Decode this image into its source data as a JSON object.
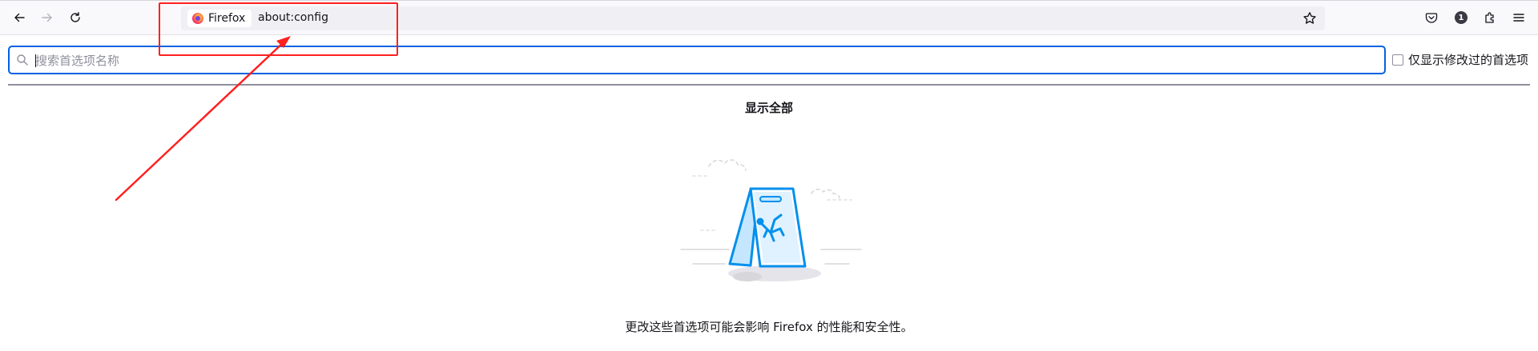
{
  "browser": {
    "identity_label": "Firefox",
    "url": "about:config",
    "notification_count": "1"
  },
  "icons": {
    "back": "arrow-left-icon",
    "forward": "arrow-right-icon",
    "reload": "reload-icon",
    "bookmark": "star-icon",
    "pocket": "pocket-icon",
    "account": "account-badge-icon",
    "extensions": "puzzle-icon",
    "menu": "hamburger-menu-icon",
    "search": "search-icon"
  },
  "config": {
    "search_placeholder": "搜索首选项名称",
    "modified_only_label": "仅显示修改过的首选项",
    "show_all_label": "显示全部",
    "warning_text": "更改这些首选项可能会影响 Firefox 的性能和安全性。"
  },
  "colors": {
    "accent": "#0061e0",
    "annotation": "#ff2020",
    "illustration_blue": "#0090ed"
  }
}
